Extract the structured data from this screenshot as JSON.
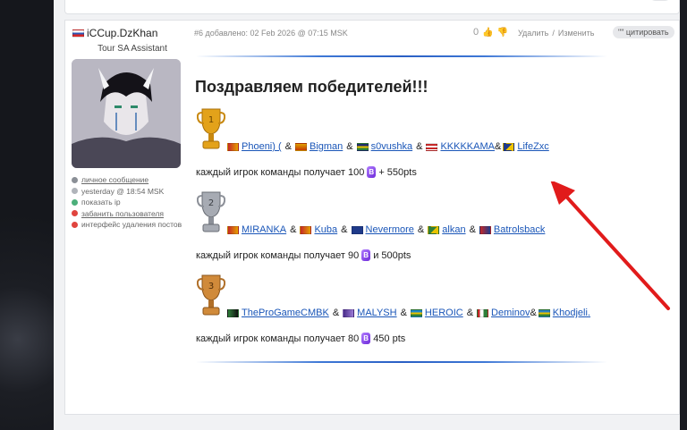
{
  "colors": {
    "accent_link": "#1a56b8",
    "arrow": "#e11b1b",
    "divider": "#2a5fc4"
  },
  "author": {
    "name": "iCCup.DzKhan",
    "flag": "ru-flag",
    "role": "Tour SA Assistant",
    "meta": [
      {
        "icon": "message-icon",
        "label": "личное сообщение",
        "link": true
      },
      {
        "icon": "clock-icon",
        "label": "yesterday @ 18:54 MSK",
        "link": false
      },
      {
        "icon": "ip-icon",
        "label": "показать ip",
        "link": false
      },
      {
        "icon": "ban-icon",
        "label": "забанить пользователя",
        "link": true
      },
      {
        "icon": "delete-icon",
        "label": "интерфейс удаления постов",
        "link": false
      }
    ]
  },
  "post": {
    "header": "#6 добавлено: 02 Feb 2026 @ 07:15 MSK",
    "votes": "0",
    "delete_label": "Удалить",
    "sep": "/",
    "edit_label": "Изменить",
    "quote_label": "цитировать",
    "quote_prefix": "\"\"",
    "title": "Поздравляем победителей!!!",
    "places": [
      {
        "trophy": "gold",
        "trophy_num": "1",
        "teams": [
          "Phoeni) (",
          "Bigman",
          "s0vushka",
          "KKKKKAMA",
          "LifeZxc"
        ],
        "prize_prefix": "каждый игрок команды получает 100",
        "prize_suffix": "+ 550pts"
      },
      {
        "trophy": "silver",
        "trophy_num": "2",
        "teams": [
          "MIRANKA",
          "Kuba",
          "Nevermore",
          "alkan",
          "Batrolsback"
        ],
        "prize_prefix": "каждый игрок команды получает 90",
        "prize_suffix": "и 500pts"
      },
      {
        "trophy": "bronze",
        "trophy_num": "3",
        "teams": [
          "TheProGameCMBK",
          "MALYSH",
          "HEROIC",
          "Deminov",
          "Khodjeli."
        ],
        "prize_prefix": "каждый игрок команды получает 80",
        "prize_suffix": "450 pts"
      }
    ],
    "amp": "&"
  }
}
